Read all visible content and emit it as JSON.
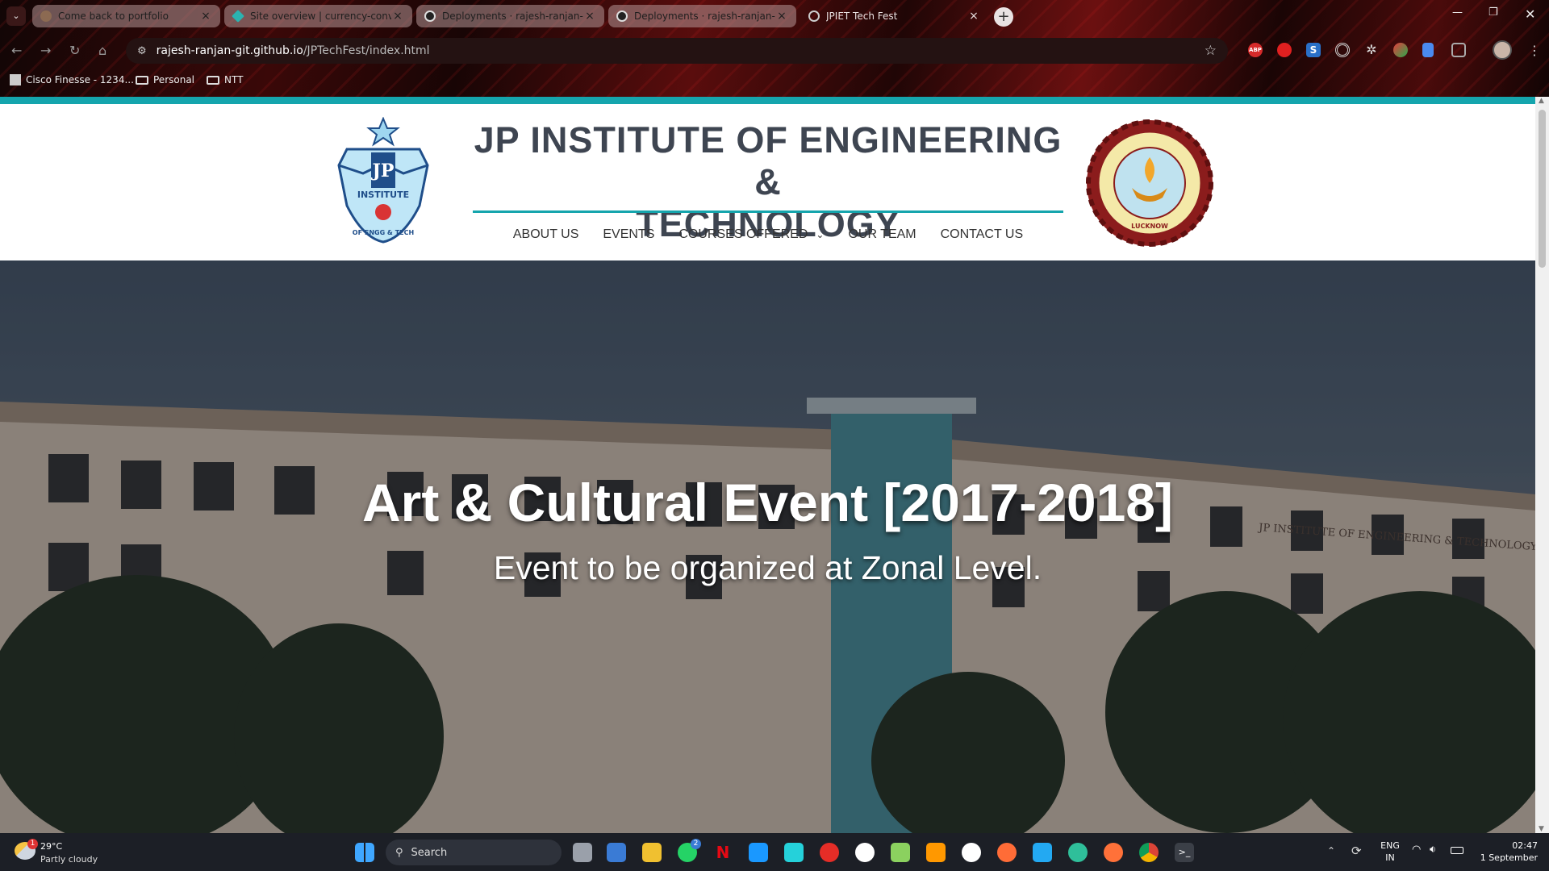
{
  "browser": {
    "tabs": [
      {
        "title": "Come back to portfolio",
        "active": false
      },
      {
        "title": "Site overview | currency-conver",
        "active": false
      },
      {
        "title": "Deployments · rajesh-ranjan-gi",
        "active": false
      },
      {
        "title": "Deployments · rajesh-ranjan-gi",
        "active": false
      },
      {
        "title": "JPIET Tech Fest",
        "active": true
      }
    ],
    "address": {
      "host": "rajesh-ranjan-git.github.io",
      "path": "/JPTechFest/index.html"
    },
    "bookmarks": [
      "Cisco Finesse - 1234...",
      "Personal",
      "NTT"
    ],
    "extensions": [
      "ABP",
      "extension-red",
      "extension-s",
      "extension-target",
      "extension-gear",
      "extension-leaf",
      "extension-doc",
      "extensions-puzzle"
    ]
  },
  "site": {
    "title_line1": "JP INSTITUTE OF ENGINEERING &",
    "title_line2": "TECHNOLOGY",
    "logo_left": {
      "text_top": "JP",
      "text_ring": "INSTITUTE",
      "text_bottom": "OF ENGG & TECH"
    },
    "logo_right": {
      "ring_text": "DR. A.P.J. ABDUL KALAM TECHNICAL UNIVERSITY UTTAR PRADESH",
      "bottom": "LUCKNOW"
    },
    "nav": [
      {
        "label": "ABOUT US",
        "dropdown": false
      },
      {
        "label": "EVENTS",
        "dropdown": false
      },
      {
        "label": "COURSES OFFERED",
        "dropdown": true
      },
      {
        "label": "OUR TEAM",
        "dropdown": false
      },
      {
        "label": "CONTACT US",
        "dropdown": false
      }
    ],
    "hero": {
      "title": "Art & Cultural Event [2017-2018]",
      "subtitle": "Event to be organized at Zonal Level.",
      "building_sign": "JP INSTITUTE OF ENGINEERING & TECHNOLOGY"
    }
  },
  "taskbar": {
    "weather": {
      "temp": "29°C",
      "desc": "Partly cloudy",
      "badge": "1"
    },
    "search_label": "Search",
    "whatsapp_badge": "2",
    "lang_line1": "ENG",
    "lang_line2": "IN",
    "time": "02:47",
    "date": "1 September"
  },
  "colors": {
    "accent": "#15a5ad",
    "title": "#3e4551"
  }
}
